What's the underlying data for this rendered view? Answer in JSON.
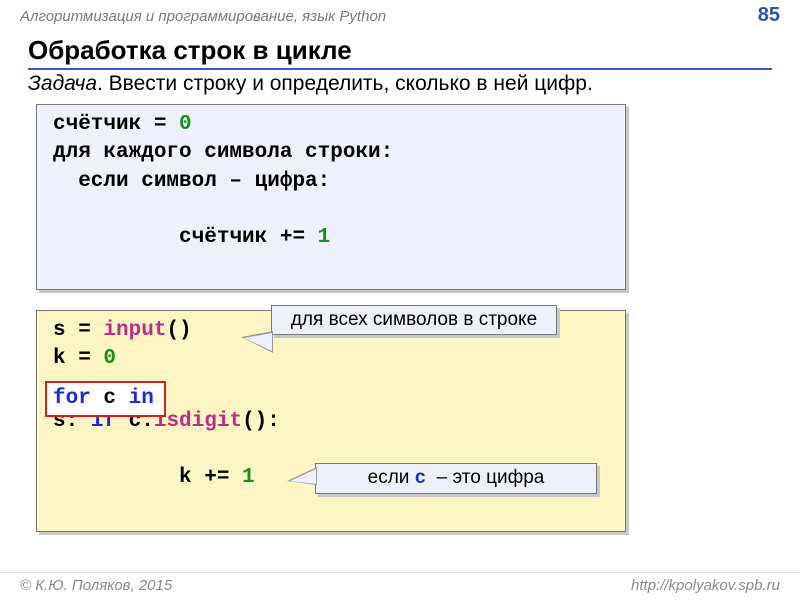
{
  "header": {
    "title": "Алгоритмизация и программирование, язык Python",
    "page": "85"
  },
  "section_title": "Обработка строк в цикле",
  "task_prefix": "Задача",
  "task_text": ". Ввести строку и определить, сколько в ней цифр.",
  "pseudo": {
    "l1a": "счётчик = ",
    "l1b": "0",
    "l2": "для каждого символа строки:",
    "l3": "  если символ – цифра:",
    "l4a": "    счётчик += ",
    "l4b": "1"
  },
  "code": {
    "l1a": "s = ",
    "l1b": "input",
    "l1c": "()",
    "l2a": "k = ",
    "l2b": "0",
    "hl_for": "for",
    "hl_c": " c ",
    "hl_in": "in",
    "l4a": "s: ",
    "l4b": "if",
    "l4c": " c.",
    "l4d": "isdigit",
    "l4e": "():",
    "l5a": "    k += ",
    "l5b": "1"
  },
  "callouts": {
    "c1": "для всех символов в строке",
    "c2_a": "если ",
    "c2_code": "c",
    "c2_b": "  – это цифра"
  },
  "footer": {
    "left": "© К.Ю. Поляков, 2015",
    "right": "http://kpolyakov.spb.ru"
  }
}
